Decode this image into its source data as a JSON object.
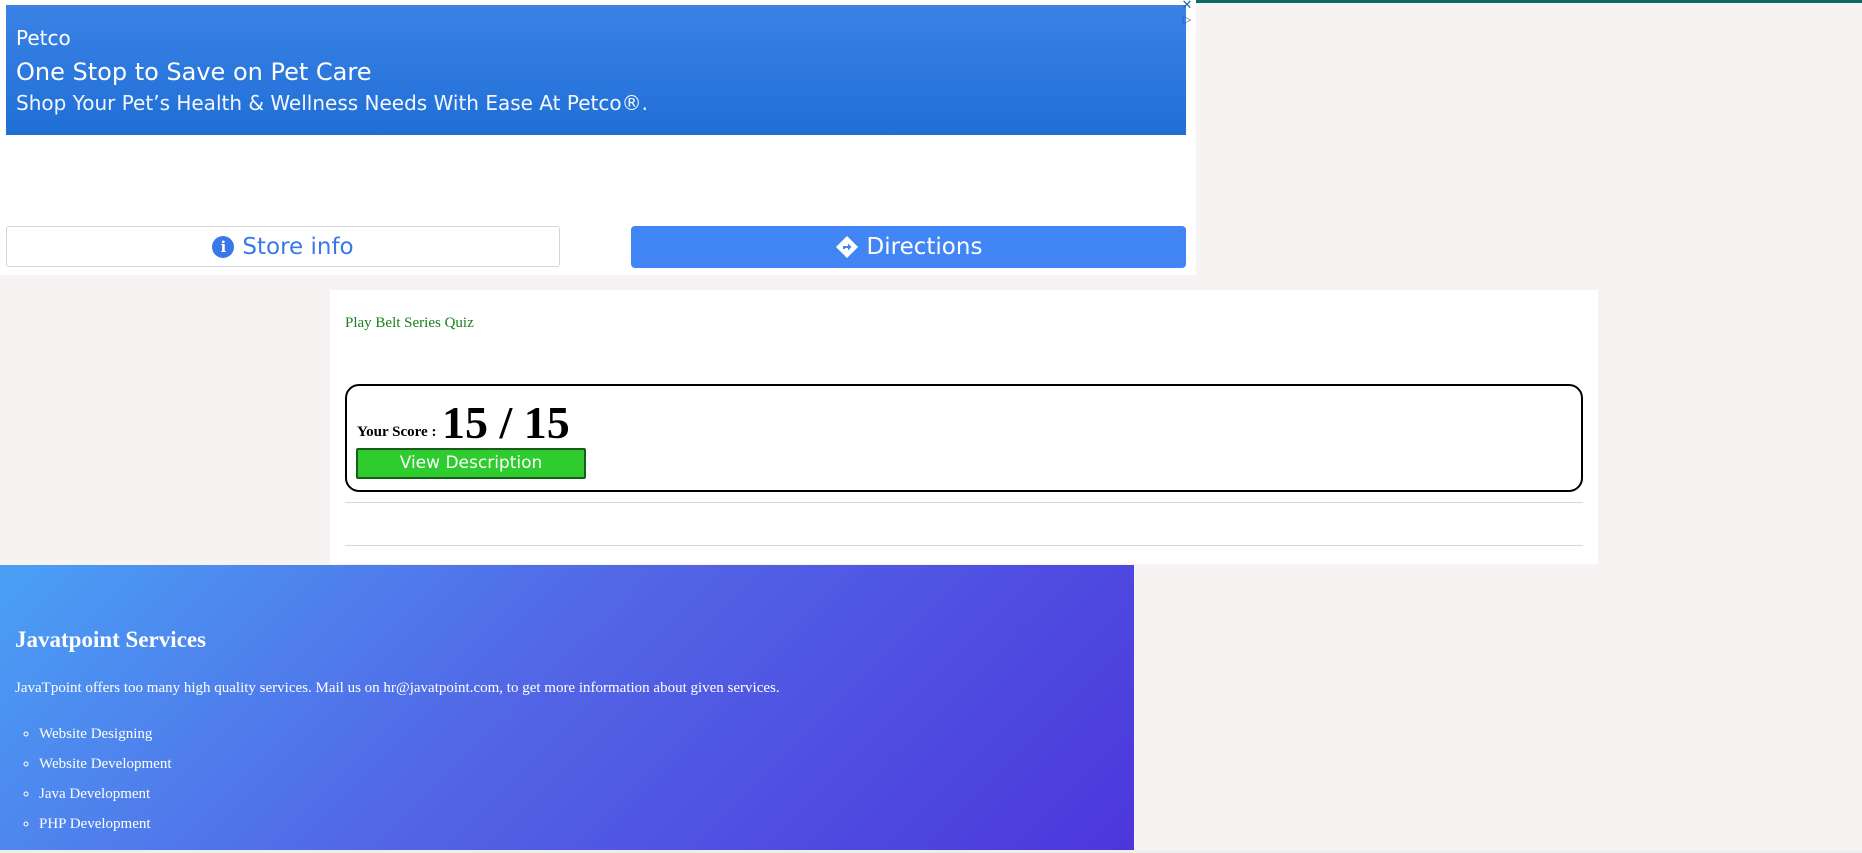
{
  "ad": {
    "brand": "Petco",
    "headline": "One Stop to Save on Pet Care",
    "subline": "Shop Your Pet’s Health & Wellness Needs With Ease At Petco®.",
    "close_glyph": "✕",
    "adchoices_glyph": "▷",
    "store_info_label": "Store info",
    "directions_label": "Directions",
    "info_glyph": "i",
    "directions_glyph": "◆"
  },
  "quiz": {
    "link_label": "Play Belt Series Quiz",
    "score_label": "Your Score :",
    "score_value": "15 / 15",
    "view_button_label": "View Description"
  },
  "services": {
    "title": "Javatpoint Services",
    "description": "JavaTpoint offers too many high quality services. Mail us on hr@javatpoint.com, to get more information about given services.",
    "items": [
      "Website Designing",
      "Website Development",
      "Java Development",
      "PHP Development"
    ]
  },
  "colors": {
    "accent_blue": "#4285f4",
    "quiz_link_green": "#1a7f1a",
    "view_button_green": "#2ecc2e"
  }
}
